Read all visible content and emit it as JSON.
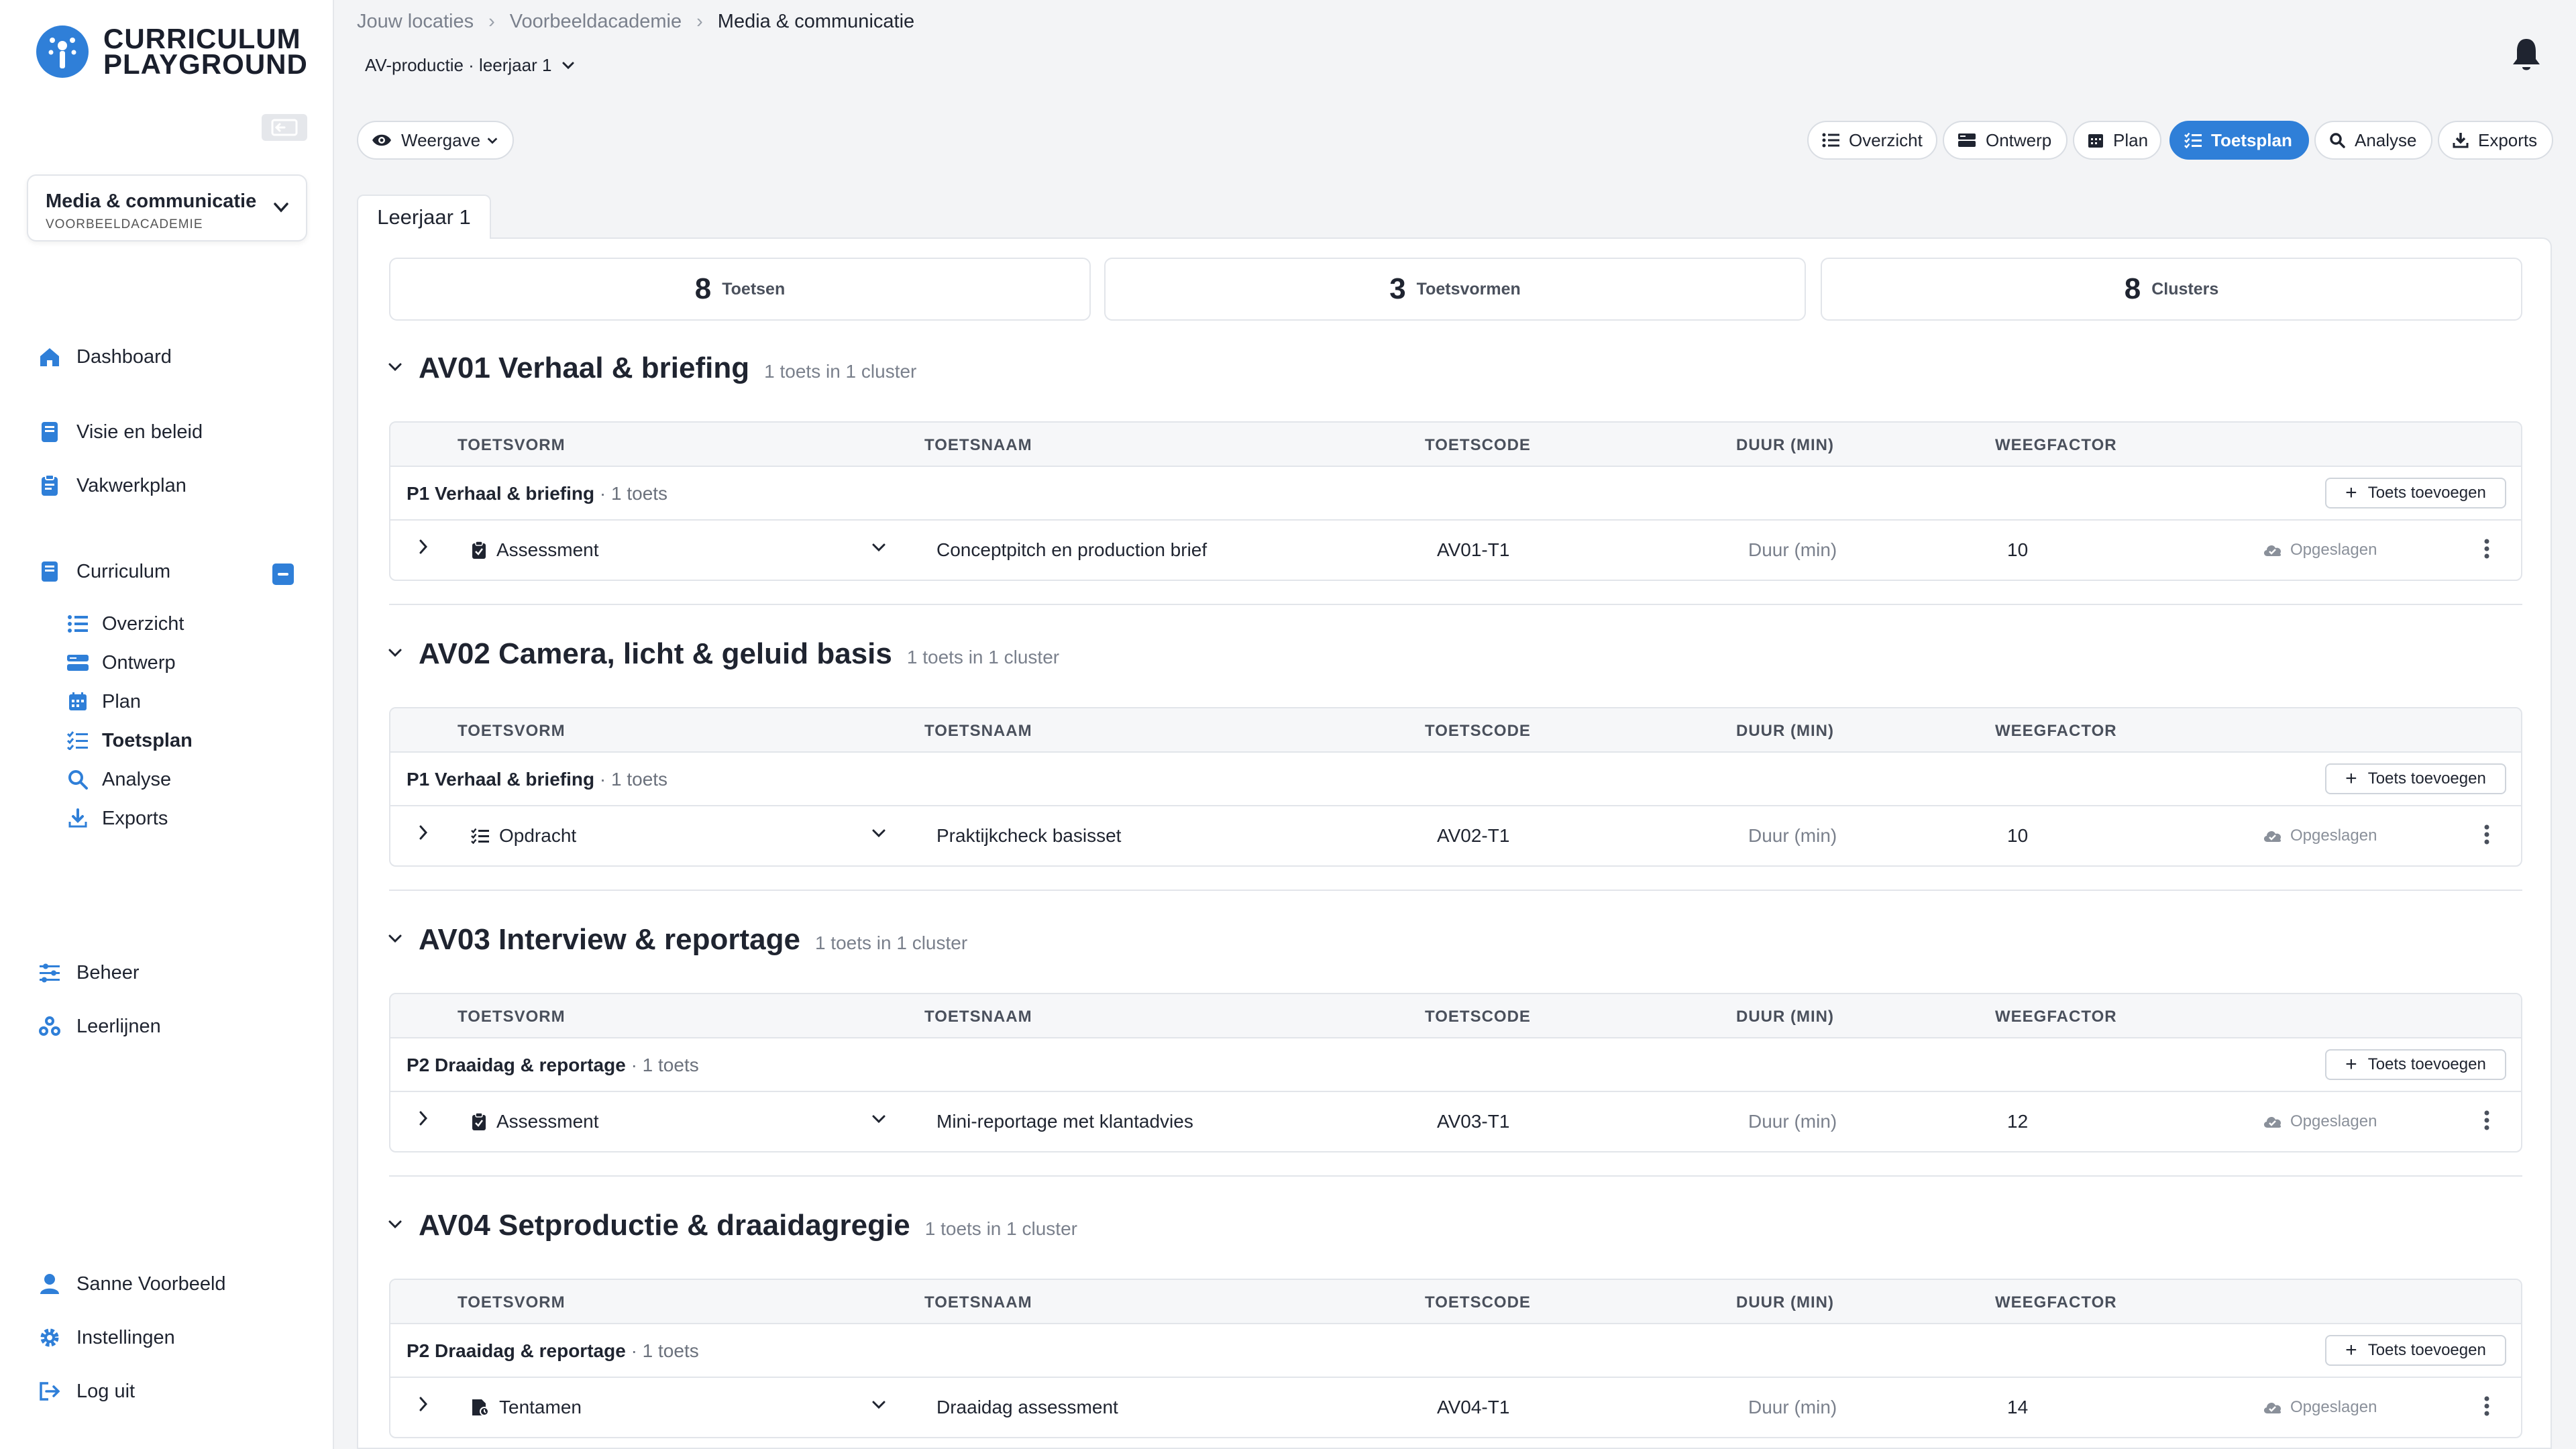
{
  "sidebar": {
    "logo_line1": "CURRICULUM",
    "logo_line2": "PLAYGROUND",
    "location": {
      "name": "Media & communicatie",
      "sub": "VOORBEELDACADEMIE"
    },
    "nav": {
      "dashboard": "Dashboard",
      "visie": "Visie en beleid",
      "vakwerkplan": "Vakwerkplan",
      "curriculum": "Curriculum",
      "sub": {
        "overzicht": "Overzicht",
        "ontwerp": "Ontwerp",
        "plan": "Plan",
        "toetsplan": "Toetsplan",
        "analyse": "Analyse",
        "exports": "Exports"
      },
      "beheer": "Beheer",
      "leerlijnen": "Leerlijnen",
      "user": "Sanne Voorbeeld",
      "instellingen": "Instellingen",
      "logout": "Log uit"
    }
  },
  "header": {
    "breadcrumb": [
      "Jouw locaties",
      "Voorbeeldacademie",
      "Media & communicatie"
    ],
    "context": "AV-productie · leerjaar 1",
    "weergave": "Weergave",
    "views": {
      "overzicht": "Overzicht",
      "ontwerp": "Ontwerp",
      "plan": "Plan",
      "toetsplan": "Toetsplan",
      "analyse": "Analyse",
      "exports": "Exports"
    }
  },
  "tab": "Leerjaar 1",
  "stats": {
    "toetsen": {
      "num": "8",
      "label": "Toetsen"
    },
    "toetsvormen": {
      "num": "3",
      "label": "Toetsvormen"
    },
    "clusters": {
      "num": "8",
      "label": "Clusters"
    }
  },
  "columns": {
    "toetsvorm": "TOETSVORM",
    "toetsnaam": "TOETSNAAM",
    "toetscode": "TOETSCODE",
    "duur": "DUUR (MIN)",
    "weegfactor": "WEEGFACTOR"
  },
  "labels": {
    "add": "Toets toevoegen",
    "saved": "Opgeslagen",
    "duur_placeholder": "Duur (min)"
  },
  "sections": [
    {
      "title": "AV01 Verhaal & briefing",
      "meta": "1 toets in 1 cluster",
      "cluster": "P1 Verhaal & briefing",
      "cluster_count": "· 1 toets",
      "toetsvorm": "Assessment",
      "toetsnaam": "Conceptpitch en production brief",
      "toetscode": "AV01-T1",
      "weegfactor": "10"
    },
    {
      "title": "AV02 Camera, licht & geluid basis",
      "meta": "1 toets in 1 cluster",
      "cluster": "P1 Verhaal & briefing",
      "cluster_count": "· 1 toets",
      "toetsvorm": "Opdracht",
      "toetsnaam": "Praktijkcheck basisset",
      "toetscode": "AV02-T1",
      "weegfactor": "10"
    },
    {
      "title": "AV03 Interview & reportage",
      "meta": "1 toets in 1 cluster",
      "cluster": "P2 Draaidag & reportage",
      "cluster_count": "· 1 toets",
      "toetsvorm": "Assessment",
      "toetsnaam": "Mini-reportage met klantadvies",
      "toetscode": "AV03-T1",
      "weegfactor": "12"
    },
    {
      "title": "AV04 Setproductie & draaidagregie",
      "meta": "1 toets in 1 cluster",
      "cluster": "P2 Draaidag & reportage",
      "cluster_count": "· 1 toets",
      "toetsvorm": "Tentamen",
      "toetsnaam": "Draaidag assessment",
      "toetscode": "AV04-T1",
      "weegfactor": "14"
    }
  ],
  "colors": {
    "accent": "#2f7fd8",
    "text": "#1f2430",
    "muted": "#7a808c"
  }
}
